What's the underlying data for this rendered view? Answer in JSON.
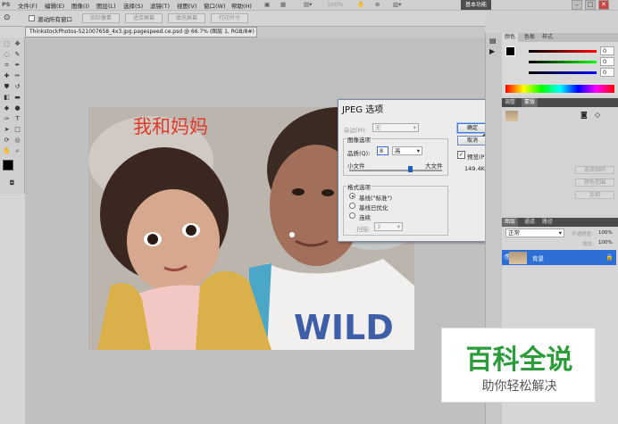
{
  "menubar": {
    "app_logo": "PS",
    "items": [
      "文件(F)",
      "编辑(E)",
      "图像(I)",
      "图层(L)",
      "选择(S)",
      "滤镜(T)",
      "视图(V)",
      "窗口(W)",
      "帮助(H)"
    ],
    "zoom": "100%",
    "workspace_button": "基本功能"
  },
  "options": {
    "checkbox_label": "滚动所有窗口",
    "buttons": [
      "实际像素",
      "适合屏幕",
      "填充屏幕",
      "打印尺寸"
    ]
  },
  "document": {
    "tab_title": "ThinkstockPhotos-521007658_4x3.jpg.pagespeed.ce.psd @ 66.7% (图层 1, RGB/8#)",
    "tab_close": "×",
    "photo_text": "我和妈妈",
    "photo_shirt_text": "WILD"
  },
  "dialog": {
    "title": "JPEG 选项",
    "close": "✕",
    "matte_label": "杂边(M):",
    "matte_value": "无",
    "image_options_label": "图像选项",
    "quality_label": "品质(Q):",
    "quality_value": "8",
    "quality_preset": "高",
    "small_file": "小文件",
    "large_file": "大文件",
    "quality_fraction": 0.63,
    "format_label": "格式选项",
    "formats": [
      "基线(\"标准\")",
      "基线已优化",
      "连续"
    ],
    "scan_label": "扫描:",
    "scan_value": "3",
    "ok": "确定",
    "cancel": "取消",
    "preview_label": "预览(P)",
    "file_size": "149.4K"
  },
  "panels": {
    "color_tabs": [
      "颜色",
      "色板",
      "样式"
    ],
    "rgb_values": [
      "0",
      "0",
      "0"
    ],
    "adjust_tabs": [
      "调整",
      "蒙版"
    ],
    "adjust_buttons": [
      "选择相同",
      "颜色范围",
      "反相"
    ],
    "layer_tabs": [
      "图层",
      "通道",
      "路径"
    ],
    "blend_mode": "正常",
    "opacity_label": "不透明度:",
    "opacity": "100%",
    "fill_label": "填充:",
    "fill": "100%",
    "layer_name": "背景"
  },
  "watermark": {
    "title": "百科全说",
    "subtitle": "助你轻松解决"
  },
  "colors": {
    "accent": "#2e6fd6",
    "watermark_green": "#2a9c3a",
    "photo_text_red": "#e03a2c"
  }
}
